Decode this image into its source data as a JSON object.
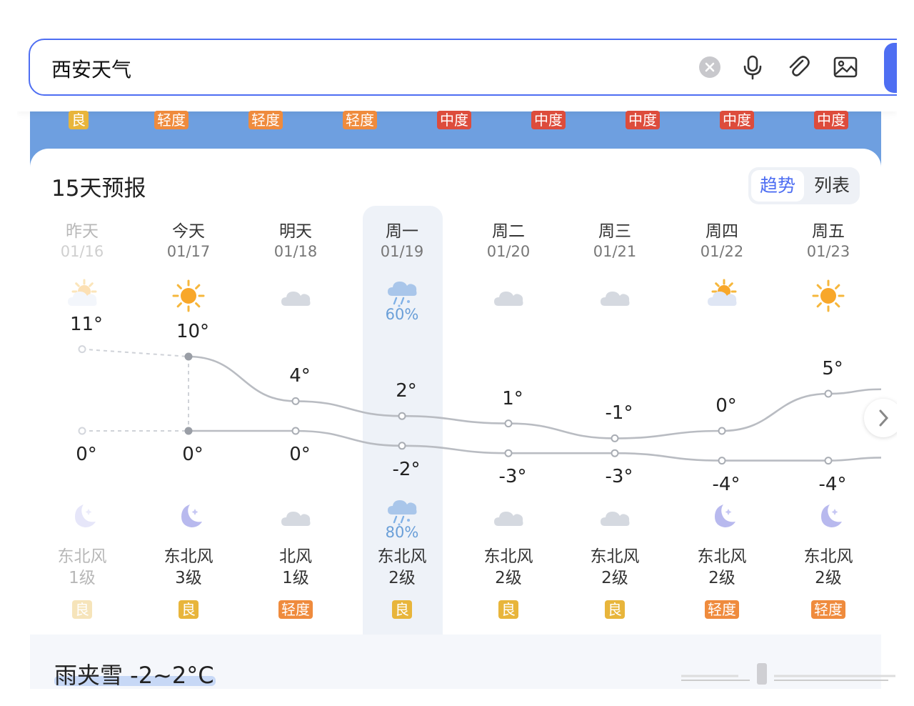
{
  "search": {
    "query": "西安天气"
  },
  "top_aqi": [
    {
      "label": "良",
      "color": "#e8b53b"
    },
    {
      "label": "轻度",
      "color": "#ef8b3d"
    },
    {
      "label": "轻度",
      "color": "#ef8b3d"
    },
    {
      "label": "轻度",
      "color": "#ef8b3d"
    },
    {
      "label": "中度",
      "color": "#dd4c3c"
    },
    {
      "label": "中度",
      "color": "#dd4c3c"
    },
    {
      "label": "中度",
      "color": "#dd4c3c"
    },
    {
      "label": "中度",
      "color": "#dd4c3c"
    },
    {
      "label": "中度",
      "color": "#dd4c3c"
    }
  ],
  "forecast": {
    "title": "15天预报",
    "toggle": {
      "trend": "趋势",
      "list": "列表"
    },
    "days": [
      {
        "day": "昨天",
        "date": "01/16",
        "day_icon": "sun-cloud-icon",
        "high": "11°",
        "low": "0°",
        "night_icon": "moon-icon",
        "wind_dir": "东北风",
        "wind_level": "1级",
        "aqi": "良",
        "aqi_color": "#e8b53b",
        "faded": true
      },
      {
        "day": "今天",
        "date": "01/17",
        "day_icon": "sun-icon",
        "high": "10°",
        "low": "0°",
        "night_icon": "moon-icon",
        "wind_dir": "东北风",
        "wind_level": "3级",
        "aqi": "良",
        "aqi_color": "#e8b53b"
      },
      {
        "day": "明天",
        "date": "01/18",
        "day_icon": "cloud-icon",
        "high": "4°",
        "low": "0°",
        "night_icon": "cloud-icon",
        "wind_dir": "北风",
        "wind_level": "1级",
        "aqi": "轻度",
        "aqi_color": "#ef8b3d"
      },
      {
        "day": "周一",
        "date": "01/19",
        "day_icon": "sleet-icon",
        "day_prob": "60%",
        "high": "2°",
        "low": "-2°",
        "night_icon": "sleet-icon",
        "night_prob": "80%",
        "wind_dir": "东北风",
        "wind_level": "2级",
        "aqi": "良",
        "aqi_color": "#e8b53b"
      },
      {
        "day": "周二",
        "date": "01/20",
        "day_icon": "cloud-icon",
        "high": "1°",
        "low": "-3°",
        "night_icon": "cloud-icon",
        "wind_dir": "东北风",
        "wind_level": "2级",
        "aqi": "良",
        "aqi_color": "#e8b53b"
      },
      {
        "day": "周三",
        "date": "01/21",
        "day_icon": "cloud-icon",
        "high": "-1°",
        "low": "-3°",
        "night_icon": "cloud-icon",
        "wind_dir": "东北风",
        "wind_level": "2级",
        "aqi": "良",
        "aqi_color": "#e8b53b"
      },
      {
        "day": "周四",
        "date": "01/22",
        "day_icon": "sun-cloud-icon",
        "high": "0°",
        "low": "-4°",
        "night_icon": "moon-icon",
        "wind_dir": "东北风",
        "wind_level": "2级",
        "aqi": "轻度",
        "aqi_color": "#ef8b3d"
      },
      {
        "day": "周五",
        "date": "01/23",
        "day_icon": "sun-icon",
        "high": "5°",
        "low": "-4°",
        "night_icon": "moon-icon",
        "wind_dir": "东北风",
        "wind_level": "2级",
        "aqi": "轻度",
        "aqi_color": "#ef8b3d"
      }
    ],
    "summary": "雨夹雪 -2~2°C"
  }
}
